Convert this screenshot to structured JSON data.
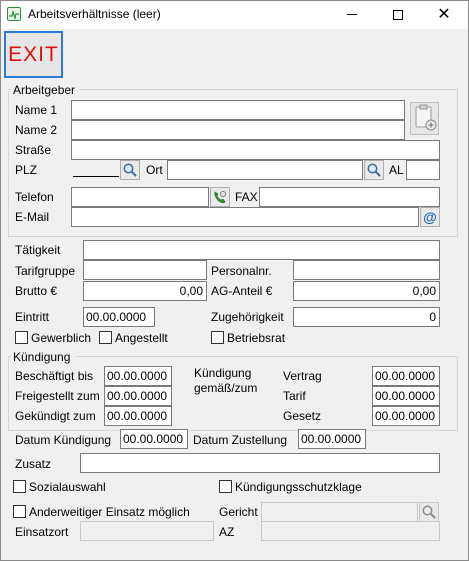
{
  "window": {
    "title": "Arbeitsverhältnisse (leer)",
    "close_glyph": "✕"
  },
  "toolbar": {
    "exit_label": "EXIT"
  },
  "arbeitgeber": {
    "group_title": "Arbeitgeber",
    "name1_label": "Name 1",
    "name2_label": "Name 2",
    "strasse_label": "Straße",
    "plz_label": "PLZ",
    "ort_label": "Ort",
    "al_label": "AL",
    "telefon_label": "Telefon",
    "fax_label": "FAX",
    "email_label": "E-Mail",
    "email_button_glyph": "@"
  },
  "taetigkeit": {
    "taetigkeit_label": "Tätigkeit",
    "tarifgruppe_label": "Tarifgruppe",
    "personalnr_label": "Personalnr.",
    "brutto_label": "Brutto €",
    "brutto_value": "0,00",
    "ag_anteil_label": "AG-Anteil €",
    "ag_anteil_value": "0,00",
    "eintritt_label": "Eintritt",
    "eintritt_value": "00.00.0000",
    "zugehoerigkeit_label": "Zugehörigkeit",
    "zugehoerigkeit_value": "0",
    "gewerblich_label": "Gewerblich",
    "angestellt_label": "Angestellt",
    "betriebsrat_label": "Betriebsrat"
  },
  "kuendigung": {
    "group_title": "Kündigung",
    "beschaeftigt_bis_label": "Beschäftigt bis",
    "beschaeftigt_bis_value": "00.00.0000",
    "freigestellt_label": "Freigestellt zum",
    "freigestellt_value": "00.00.0000",
    "gekuendigt_label": "Gekündigt zum",
    "gekuendigt_value": "00.00.0000",
    "gemaess_line1": "Kündigung",
    "gemaess_line2": "gemäß/zum",
    "vertrag_label": "Vertrag",
    "vertrag_value": "00.00.0000",
    "tarif_label": "Tarif",
    "tarif_value": "00.00.0000",
    "gesetz_label": "Gesetz",
    "gesetz_value": "00.00.0000",
    "datum_kuendigung_label": "Datum Kündigung",
    "datum_kuendigung_value": "00.00.0000",
    "datum_zustellung_label": "Datum Zustellung",
    "datum_zustellung_value": "00.00.0000",
    "zusatz_label": "Zusatz",
    "sozialauswahl_label": "Sozialauswahl",
    "kschutzklage_label": "Kündigungsschutzklage",
    "anderweitiger_label": "Anderweitiger Einsatz möglich",
    "gericht_label": "Gericht",
    "einsatzort_label": "Einsatzort",
    "az_label": "AZ"
  },
  "icons": {
    "search": "search-icon",
    "phone": "phone-icon",
    "email": "email-icon",
    "clipboard": "clipboard-add-icon"
  },
  "colors": {
    "exit_text": "#e01010",
    "focus_border": "#2b7bd6"
  }
}
